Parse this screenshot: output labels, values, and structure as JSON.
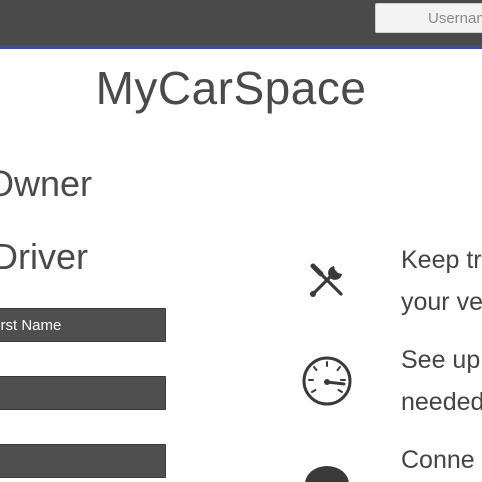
{
  "header": {
    "username_placeholder": "Username"
  },
  "brand": {
    "title": "MyCarSpace"
  },
  "signup": {
    "owner_heading": "Owner",
    "driver_heading": "Driver",
    "fields": [
      {
        "placeholder": "First Name"
      },
      {
        "placeholder": ""
      },
      {
        "placeholder": ""
      }
    ]
  },
  "features": [
    {
      "icon": "wrench-screwdriver-icon",
      "line1": "Keep tr",
      "line2": "your ve"
    },
    {
      "icon": "speedometer-icon",
      "line1": "See up",
      "line2": "needed"
    },
    {
      "icon": "dark-circle-icon",
      "line1": "Conne",
      "line2": ""
    }
  ],
  "colors": {
    "topbar": "#4a4a4a",
    "topbar_accent": "#3c4c9c",
    "field_bg": "#4f4f4f",
    "text": "#4a4a4a"
  }
}
